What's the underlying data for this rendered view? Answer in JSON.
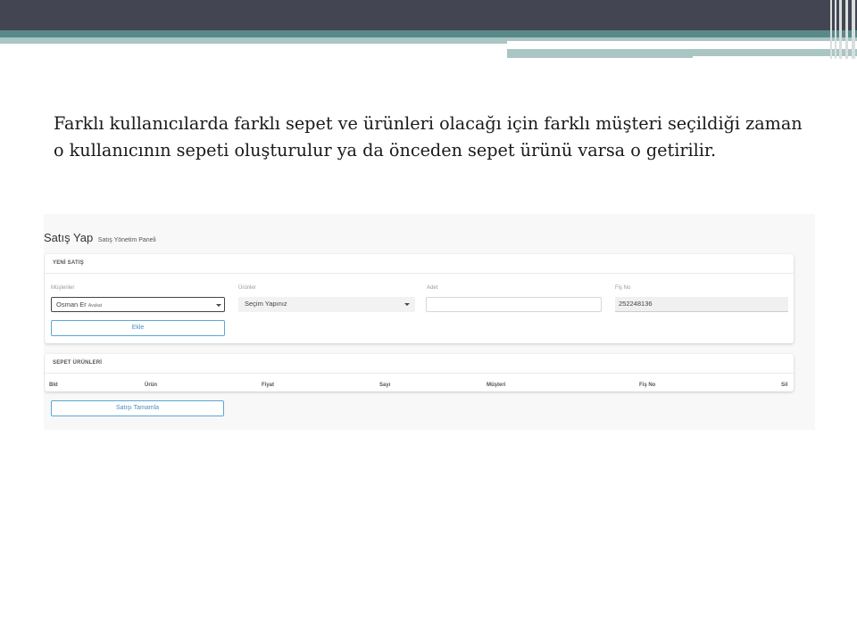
{
  "slide": {
    "body_text": "Farklı kullanıcılarda farklı sepet ve ürünleri olacağı için farklı müşteri seçildiği zaman o kullanıcının sepeti oluşturulur ya da önceden sepet ürünü varsa o getirilir."
  },
  "app": {
    "title": "Satış Yap",
    "subtitle": "Satış Yönetim Paneli",
    "new_sale": {
      "header": "YENİ SATIŞ",
      "customer_label": "Müşteriler",
      "customer_value": "Osman Er",
      "customer_sub": "Avukat",
      "product_label": "Ürünler",
      "product_value": "Seçim Yapınız",
      "quantity_label": "Adet",
      "quantity_value": "",
      "receipt_label": "Fiş No",
      "receipt_value": "252248136",
      "add_button": "Ekle"
    },
    "cart": {
      "header": "SEPET ÜRÜNLERİ",
      "columns": [
        "BId",
        "Ürün",
        "Fiyat",
        "Sayı",
        "Müşteri",
        "Fiş No",
        "Sil"
      ],
      "complete_button": "Satışı Tamamla"
    }
  }
}
